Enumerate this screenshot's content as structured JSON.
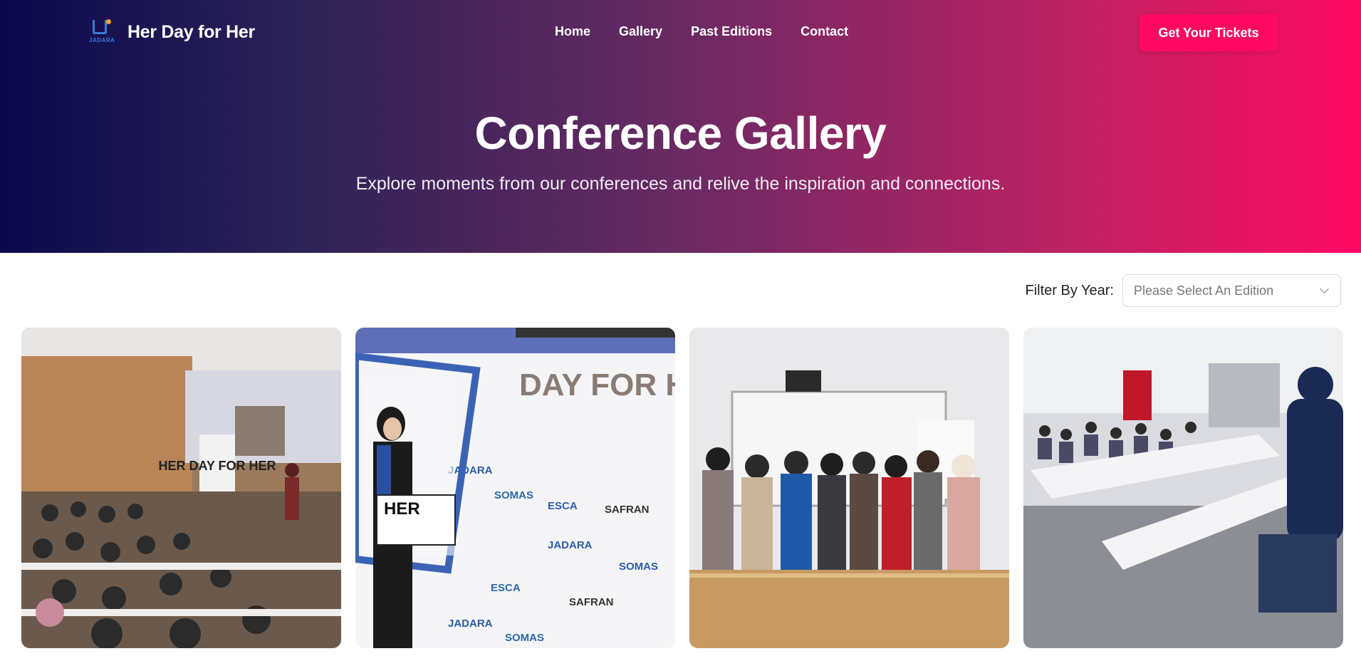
{
  "brand": {
    "name": "Her Day for Her",
    "logo_text": "JADARA"
  },
  "nav": {
    "items": [
      {
        "label": "Home"
      },
      {
        "label": "Gallery"
      },
      {
        "label": "Past Editions"
      },
      {
        "label": "Contact"
      }
    ],
    "cta_label": "Get Your Tickets"
  },
  "hero": {
    "title": "Conference Gallery",
    "subtitle": "Explore moments from our conferences and relive the inspiration and connections."
  },
  "filter": {
    "label": "Filter By Year:",
    "placeholder": "Please Select An Edition"
  },
  "gallery": {
    "photos": [
      {
        "name": "auditorium-photo",
        "screen_text": "HER DAY FOR HER"
      },
      {
        "name": "photo-booth-photo",
        "banner_text": "DAY FOR HER",
        "frame_text": "HER",
        "sponsor_texts": [
          "JADARA",
          "SOMAS",
          "ESCA",
          "SAFRAN"
        ]
      },
      {
        "name": "group-photo"
      },
      {
        "name": "workshop-photo"
      }
    ]
  },
  "colors": {
    "hero_start": "#0b0a4d",
    "hero_end": "#ff0a62",
    "accent": "#ff0a62"
  }
}
